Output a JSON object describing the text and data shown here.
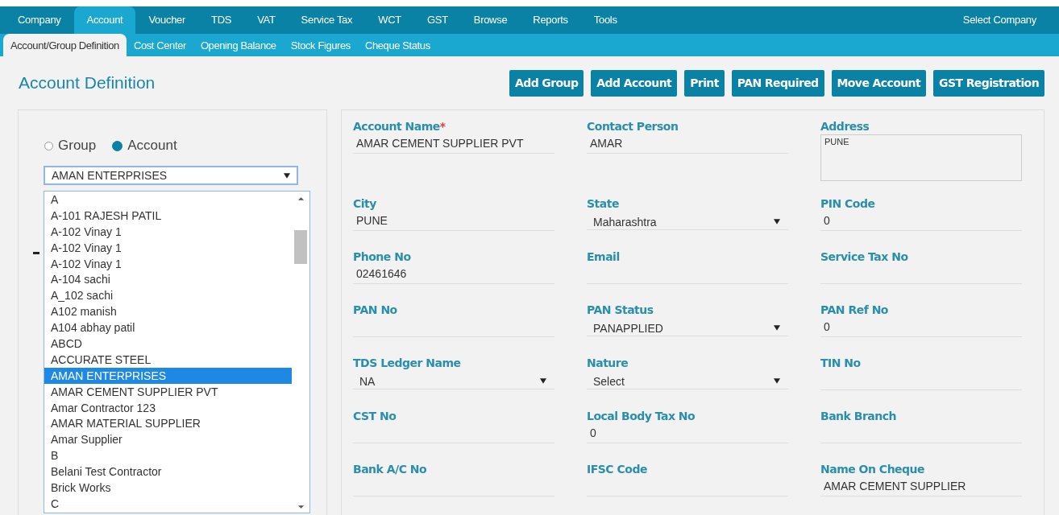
{
  "menu": [
    {
      "label": "Company",
      "selected": false
    },
    {
      "label": "Account",
      "selected": true
    },
    {
      "label": "Voucher",
      "selected": false
    },
    {
      "label": "TDS",
      "selected": false
    },
    {
      "label": "VAT",
      "selected": false
    },
    {
      "label": "Service Tax",
      "selected": false
    },
    {
      "label": "WCT",
      "selected": false
    },
    {
      "label": "GST",
      "selected": false
    },
    {
      "label": "Browse",
      "selected": false
    },
    {
      "label": "Reports",
      "selected": false
    },
    {
      "label": "Tools",
      "selected": false
    }
  ],
  "select_company": "Select Company",
  "required_mark": "*",
  "subtabs": [
    {
      "label": "Account/Group Definition",
      "selected": true
    },
    {
      "label": "Cost Center",
      "selected": false
    },
    {
      "label": "Opening Balance",
      "selected": false
    },
    {
      "label": "Stock Figures",
      "selected": false
    },
    {
      "label": "Cheque Status",
      "selected": false
    }
  ],
  "page_title": "Account Definition",
  "buttons": [
    "Add Group",
    "Add Account",
    "Print",
    "PAN Required",
    "Move Account",
    "GST Registration"
  ],
  "type_options": [
    {
      "label": "Group",
      "selected": false
    },
    {
      "label": "Account",
      "selected": true
    }
  ],
  "account_select": {
    "value": "AMAN ENTERPRISES",
    "options": [
      {
        "label": "A",
        "selected": false
      },
      {
        "label": "A-101 RAJESH PATIL",
        "selected": false
      },
      {
        "label": "A-102 Vinay 1",
        "selected": false
      },
      {
        "label": "A-102 Vinay 1",
        "selected": false
      },
      {
        "label": "A-102 Vinay 1",
        "selected": false
      },
      {
        "label": "A-104 sachi",
        "selected": false
      },
      {
        "label": "A_102 sachi",
        "selected": false
      },
      {
        "label": "A102 manish",
        "selected": false
      },
      {
        "label": "A104 abhay patil",
        "selected": false
      },
      {
        "label": "ABCD",
        "selected": false
      },
      {
        "label": "ACCURATE STEEL",
        "selected": false
      },
      {
        "label": "AMAN ENTERPRISES",
        "selected": true
      },
      {
        "label": "AMAR CEMENT SUPPLIER PVT",
        "selected": false
      },
      {
        "label": "Amar Contractor 123",
        "selected": false
      },
      {
        "label": "AMAR MATERIAL SUPPLIER",
        "selected": false
      },
      {
        "label": "Amar Supplier",
        "selected": false
      },
      {
        "label": "B",
        "selected": false
      },
      {
        "label": "Belani Test Contractor",
        "selected": false
      },
      {
        "label": "Brick Works",
        "selected": false
      },
      {
        "label": "C",
        "selected": false
      }
    ]
  },
  "fields": [
    {
      "label": "Account Name",
      "required": true,
      "kind": "text",
      "value": "AMAR CEMENT SUPPLIER PVT"
    },
    {
      "label": "Contact Person",
      "required": false,
      "kind": "text",
      "value": "AMAR"
    },
    {
      "label": "Address",
      "required": false,
      "kind": "textarea",
      "value": "PUNE"
    },
    {
      "label": "City",
      "required": false,
      "kind": "text",
      "value": "PUNE"
    },
    {
      "label": "State",
      "required": false,
      "kind": "select",
      "value": "Maharashtra"
    },
    {
      "label": "PIN Code",
      "required": false,
      "kind": "text",
      "value": "0"
    },
    {
      "label": "Phone No",
      "required": false,
      "kind": "text",
      "value": "02461646"
    },
    {
      "label": "Email",
      "required": false,
      "kind": "text"
    },
    {
      "label": "Service Tax No",
      "required": false,
      "kind": "text"
    },
    {
      "label": "PAN No",
      "required": false,
      "kind": "text"
    },
    {
      "label": "PAN Status",
      "required": false,
      "kind": "select",
      "value": "PANAPPLIED"
    },
    {
      "label": "PAN Ref No",
      "required": false,
      "kind": "text",
      "value": "0"
    },
    {
      "label": "TDS Ledger Name",
      "required": false,
      "kind": "select",
      "value": "NA"
    },
    {
      "label": "Nature",
      "required": false,
      "kind": "select",
      "value": "Select"
    },
    {
      "label": "TIN No",
      "required": false,
      "kind": "text"
    },
    {
      "label": "CST No",
      "required": false,
      "kind": "text"
    },
    {
      "label": "Local Body Tax No",
      "required": false,
      "kind": "text",
      "value": "0"
    },
    {
      "label": "Bank Branch",
      "required": false,
      "kind": "text"
    },
    {
      "label": "Bank A/C No",
      "required": false,
      "kind": "text"
    },
    {
      "label": "IFSC Code",
      "required": false,
      "kind": "text"
    },
    {
      "label": "Name On Cheque",
      "required": false,
      "kind": "text",
      "value": "AMAR CEMENT SUPPLIER"
    }
  ]
}
